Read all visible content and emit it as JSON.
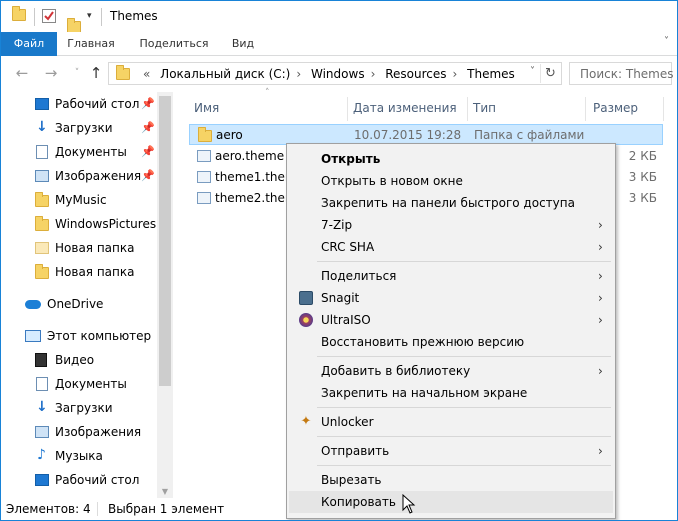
{
  "window": {
    "title": "Themes"
  },
  "ribbon": {
    "tabs": [
      "Файл",
      "Главная",
      "Поделиться",
      "Вид"
    ]
  },
  "address": {
    "crumbs": [
      "«",
      "Локальный диск (C:)",
      "Windows",
      "Resources",
      "Themes"
    ],
    "search_placeholder": "Поиск: Themes"
  },
  "nav_pane": {
    "items": [
      {
        "label": "Рабочий стол",
        "icon": "desktop-icon",
        "pinned": true
      },
      {
        "label": "Загрузки",
        "icon": "downloads-icon",
        "pinned": true
      },
      {
        "label": "Документы",
        "icon": "documents-icon",
        "pinned": true
      },
      {
        "label": "Изображения",
        "icon": "pictures-icon",
        "pinned": true
      },
      {
        "label": "MyMusic",
        "icon": "folder-icon",
        "pinned": false
      },
      {
        "label": "WindowsPictures",
        "icon": "folder-icon",
        "pinned": false
      },
      {
        "label": "Новая папка",
        "icon": "folder-icon",
        "pinned": false
      },
      {
        "label": "Новая папка",
        "icon": "folder-icon",
        "pinned": false
      },
      {
        "label": "OneDrive",
        "icon": "onedrive-icon",
        "pinned": false
      },
      {
        "label": "Этот компьютер",
        "icon": "computer-icon",
        "pinned": false
      },
      {
        "label": "Видео",
        "icon": "videos-icon",
        "pinned": false
      },
      {
        "label": "Документы",
        "icon": "documents-icon",
        "pinned": false
      },
      {
        "label": "Загрузки",
        "icon": "downloads-icon",
        "pinned": false
      },
      {
        "label": "Изображения",
        "icon": "pictures-icon",
        "pinned": false
      },
      {
        "label": "Музыка",
        "icon": "music-icon",
        "pinned": false
      },
      {
        "label": "Рабочий стол",
        "icon": "desktop-icon",
        "pinned": false
      }
    ]
  },
  "file_list": {
    "columns": [
      "Имя",
      "Дата изменения",
      "Тип",
      "Размер"
    ],
    "rows": [
      {
        "name": "aero",
        "date": "10.07.2015 19:28",
        "type": "Папка с файлами",
        "size": "",
        "selected": true
      },
      {
        "name": "aero.theme",
        "date": "",
        "type": "",
        "size": "2 КБ",
        "selected": false
      },
      {
        "name": "theme1.theme",
        "date": "",
        "type": "",
        "size": "3 КБ",
        "selected": false
      },
      {
        "name": "theme2.theme",
        "date": "",
        "type": "",
        "size": "3 КБ",
        "selected": false
      }
    ]
  },
  "status": {
    "count": "Элементов: 4",
    "selected": "Выбран 1 элемент"
  },
  "context_menu": {
    "items": [
      {
        "label": "Открыть",
        "bold": true
      },
      {
        "label": "Открыть в новом окне"
      },
      {
        "label": "Закрепить на панели быстрого доступа"
      },
      {
        "label": "7-Zip",
        "submenu": true
      },
      {
        "label": "CRC SHA",
        "submenu": true
      },
      {
        "label": "Поделиться",
        "submenu": true
      },
      {
        "label": "Snagit",
        "submenu": true,
        "icon": "snagit-icon"
      },
      {
        "label": "UltraISO",
        "submenu": true,
        "icon": "ultraiso-icon"
      },
      {
        "label": "Восстановить прежнюю версию"
      },
      {
        "label": "Добавить в библиотеку",
        "submenu": true
      },
      {
        "label": "Закрепить на начальном экране"
      },
      {
        "label": "Unlocker",
        "icon": "unlocker-icon"
      },
      {
        "label": "Отправить",
        "submenu": true
      },
      {
        "label": "Вырезать"
      },
      {
        "label": "Копировать",
        "highlighted": true
      }
    ]
  }
}
